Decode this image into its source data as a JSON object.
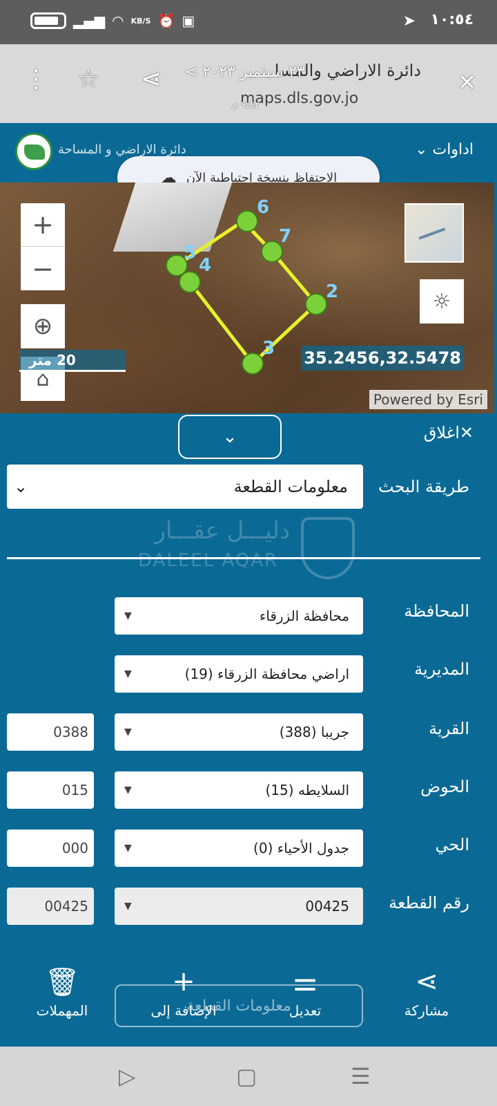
{
  "status": {
    "time": "١٠:٥٤",
    "speed": "KB/S"
  },
  "toolbar": {
    "title": "دائرة الاراضي والمسا",
    "date": "٢٣ سبتمبر ٢٠٢٣ >",
    "url": "maps.dls.gov.jo",
    "time": "٩:٤٢ م"
  },
  "appbar": {
    "tools_label": "اداوات",
    "department": "دائرة الاراضي و المساحة"
  },
  "backup": {
    "label": "الاحتفاظ بنسخة احتياطية الآن"
  },
  "map": {
    "scale_label": "20 متر",
    "coordinates": "35.2456,32.5478",
    "attribution": "Powered by Esri",
    "parcel_points": [
      {
        "label": "2"
      },
      {
        "label": "3"
      },
      {
        "label": "4"
      },
      {
        "label": "5"
      },
      {
        "label": "6"
      },
      {
        "label": "7"
      }
    ]
  },
  "panel": {
    "close_label": "اغلاق",
    "search_method_label": "طريقة البحث",
    "search_method_value": "معلومات القطعة",
    "watermark_ar": "دليـــل عقـــار",
    "watermark_en": "DALEEL AQAR",
    "fields": {
      "governorate": {
        "label": "المحافظة",
        "value": "محافظة الزرقاء"
      },
      "directorate": {
        "label": "المديرية",
        "value": "اراضي محافظة الزرقاء (19)"
      },
      "village": {
        "label": "القرية",
        "value": "جريبا (388)",
        "code": "0388"
      },
      "basin": {
        "label": "الحوض",
        "value": "السلايطه (15)",
        "code": "015"
      },
      "district": {
        "label": "الحي",
        "value": "جدول الأحياء (0)",
        "code": "000"
      },
      "parcel": {
        "label": "رقم القطعة",
        "value": "00425",
        "code": "00425"
      }
    }
  },
  "actions": {
    "share": "مشاركة",
    "edit": "تعديل",
    "add": "الإضافة إلى",
    "trash": "المهملات",
    "ghost": "معلومات القطعة"
  },
  "colors": {
    "panel": "#0b6a95",
    "parcel_line": "#e6f22a",
    "parcel_point": "#7cd13a"
  }
}
